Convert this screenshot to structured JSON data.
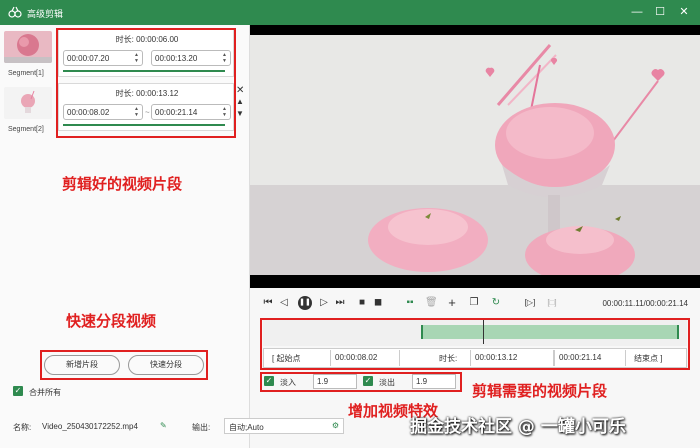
{
  "window": {
    "title": "高级剪辑",
    "minimize": "—",
    "maximize": "☐",
    "close": "✕"
  },
  "segments": [
    {
      "label": "Segment[1]",
      "duration_label": "时长:",
      "duration": "00:00:06.00",
      "start": "00:00:07.20",
      "end": "00:00:13.20"
    },
    {
      "label": "Segment[2]",
      "duration_label": "时长:",
      "duration": "00:00:13.12",
      "start": "00:00:08.02",
      "end": "00:00:21.14",
      "separator": "~"
    }
  ],
  "annotations": {
    "clipped_segments": "剪辑好的视频片段",
    "quick_split": "快速分段视频",
    "need_segment": "剪辑需要的视频片段",
    "add_effects": "增加视频特效"
  },
  "buttons": {
    "add_segment": "新增片段",
    "quick_split": "快速分段"
  },
  "merge_all": "合并所有",
  "playback": {
    "time": "00:00:11.11/00:00:21.14"
  },
  "range": {
    "start_btn": "[ 起始点",
    "start_value": "00:00:08.02",
    "duration_label": "时长:",
    "duration_value": "00:00:13.12",
    "end_value": "00:00:21.14",
    "end_btn": "结束点 ]"
  },
  "effects": {
    "fade_in_label": "淡入",
    "fade_in_value": "1.9",
    "fade_out_label": "淡出",
    "fade_out_value": "1.9"
  },
  "footer": {
    "name_label": "名称:",
    "name_value": "Video_250430172252.mp4",
    "output_label": "输出:",
    "output_value": "自动;Auto"
  },
  "watermark": "掘金技术社区 @ 一罐小可乐",
  "colors": {
    "accent": "#2f8a4f",
    "annotation": "#e02020"
  }
}
